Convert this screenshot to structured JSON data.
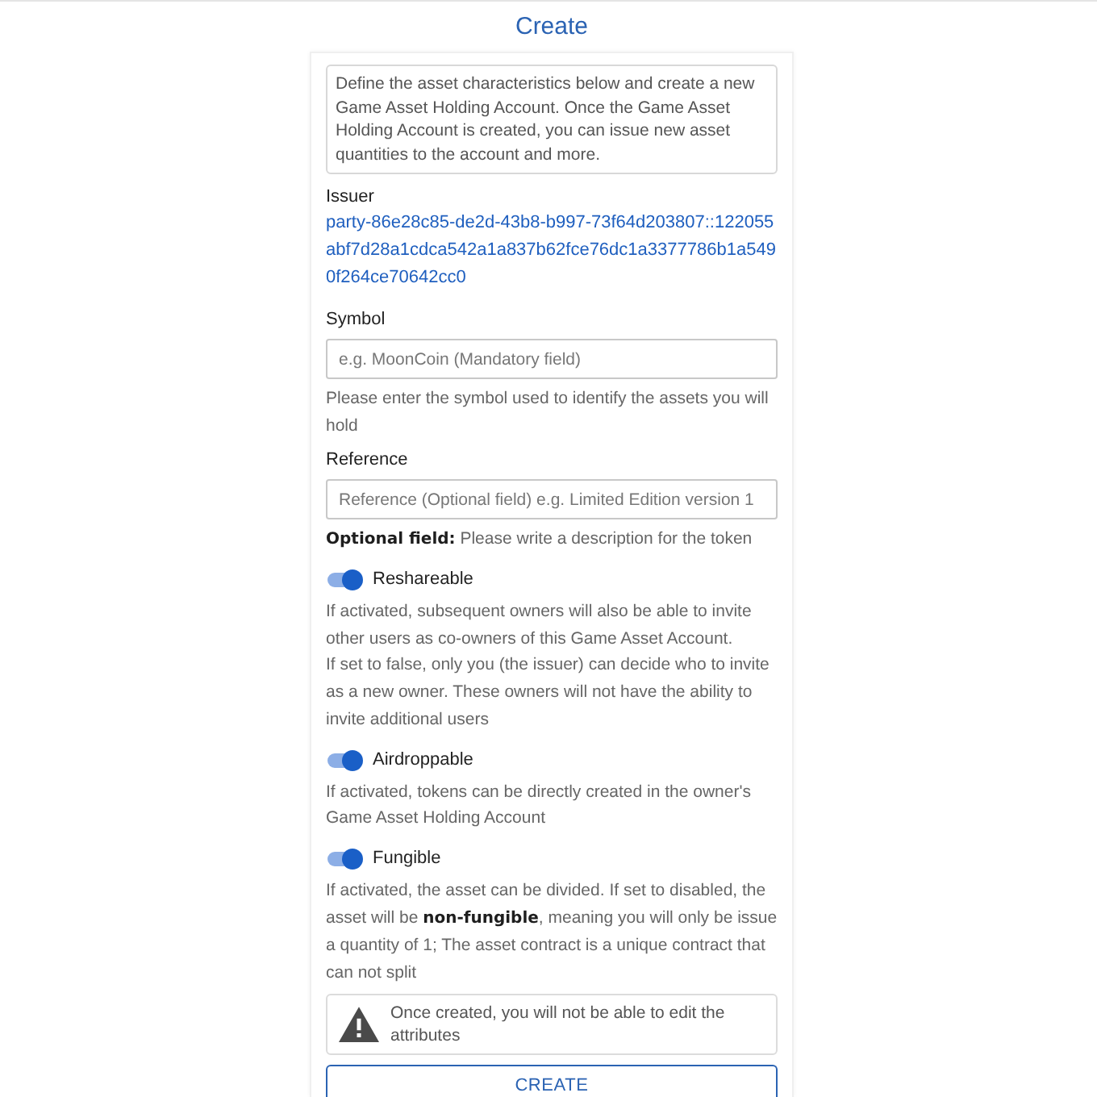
{
  "title": "Create",
  "intro": "Define the asset characteristics below and create a new Game Asset Holding Account. Once the Game Asset Holding Account is created, you can issue new asset quantities to the account and more.",
  "issuer": {
    "label": "Issuer",
    "value": "party-86e28c85-de2d-43b8-b997-73f64d203807::122055abf7d28a1cdca542a1a837b62fce76dc1a3377786b1a5490f264ce70642cc0"
  },
  "fields": [
    {
      "label": "Symbol",
      "placeholder": "e.g. MoonCoin (Mandatory field)",
      "hint": "Please enter the symbol used to identify the assets you will hold"
    },
    {
      "label": "Reference",
      "placeholder": "Reference (Optional field) e.g. Limited Edition version 1",
      "hint": "**Optional field:** Please write a description for the token"
    }
  ],
  "toggles": [
    {
      "label": "Reshareable",
      "on": true,
      "description": "If activated, subsequent owners will also be able to invite other users as co-owners of this Game Asset Account.\nIf set to false, only you (the issuer) can decide who to invite as a new owner. These owners will not have the ability to invite additional users"
    },
    {
      "label": "Airdroppable",
      "on": true,
      "description": "If activated, tokens can be directly created in the owner's Game Asset Holding Account"
    },
    {
      "label": "Fungible",
      "on": true,
      "description": "If activated, the asset can be divided. If set to disabled, the asset will be **non-fungible**, meaning you will only be issue a quantity of 1; The asset contract is a unique contract that can not split"
    }
  ],
  "warning": {
    "text": "Once created, you will not be able to edit the attributes"
  },
  "button": {
    "label": "CREATE"
  }
}
